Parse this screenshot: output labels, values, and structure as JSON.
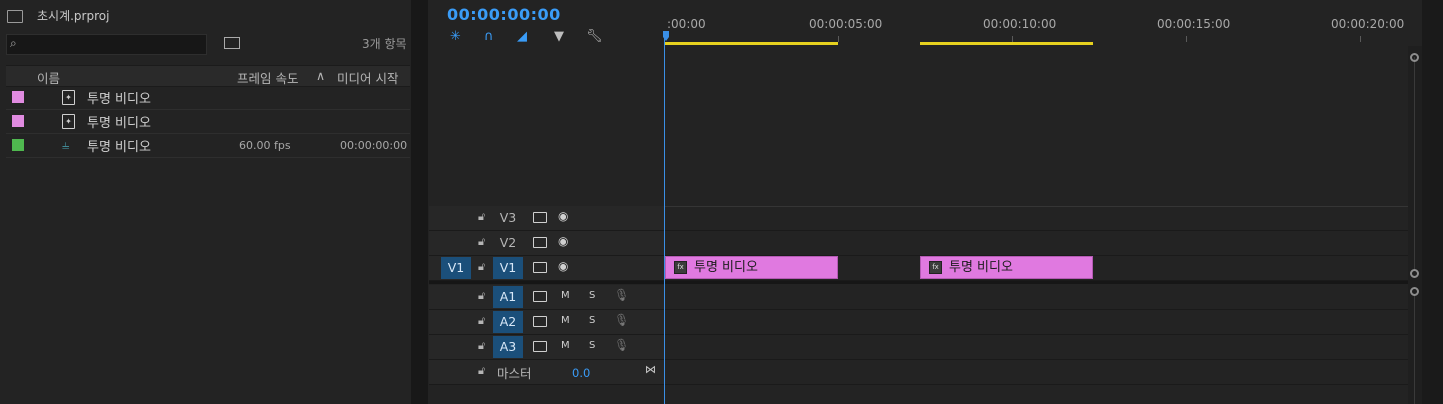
{
  "project": {
    "title": "초시계.prproj",
    "search_placeholder": "",
    "item_count": "3개 항목",
    "columns": {
      "name": "이름",
      "fps": "프레임 속도",
      "media_start": "미디어 시작"
    },
    "items": [
      {
        "name": "투명 비디오",
        "color": "#e08be0",
        "icon": "video-clip-icon",
        "fps": "",
        "start": ""
      },
      {
        "name": "투명 비디오",
        "color": "#e08be0",
        "icon": "video-clip-icon",
        "fps": "",
        "start": ""
      },
      {
        "name": "투명 비디오",
        "color": "#4fb84f",
        "icon": "sequence-icon",
        "fps": "60.00 fps",
        "start": "00:00:00:00"
      }
    ]
  },
  "timeline": {
    "timecode": "00:00:00:00",
    "ruler": [
      ":00:00",
      "00:00:05:00",
      "00:00:10:00",
      "00:00:15:00",
      "00:00:20:00"
    ],
    "video_tracks": [
      {
        "label": "V3"
      },
      {
        "label": "V2"
      },
      {
        "label": "V1",
        "source": "V1"
      }
    ],
    "audio_tracks": [
      {
        "label": "A1",
        "m": "M",
        "s": "S"
      },
      {
        "label": "A2",
        "m": "M",
        "s": "S"
      },
      {
        "label": "A3",
        "m": "M",
        "s": "S"
      }
    ],
    "master": {
      "label": "마스터",
      "value": "0.0"
    },
    "clips": [
      {
        "name": "투명 비디오",
        "fx": "fx"
      },
      {
        "name": "투명 비디오",
        "fx": "fx"
      }
    ],
    "clip_color": "#e079e0",
    "accent": "#3a9cf7"
  }
}
